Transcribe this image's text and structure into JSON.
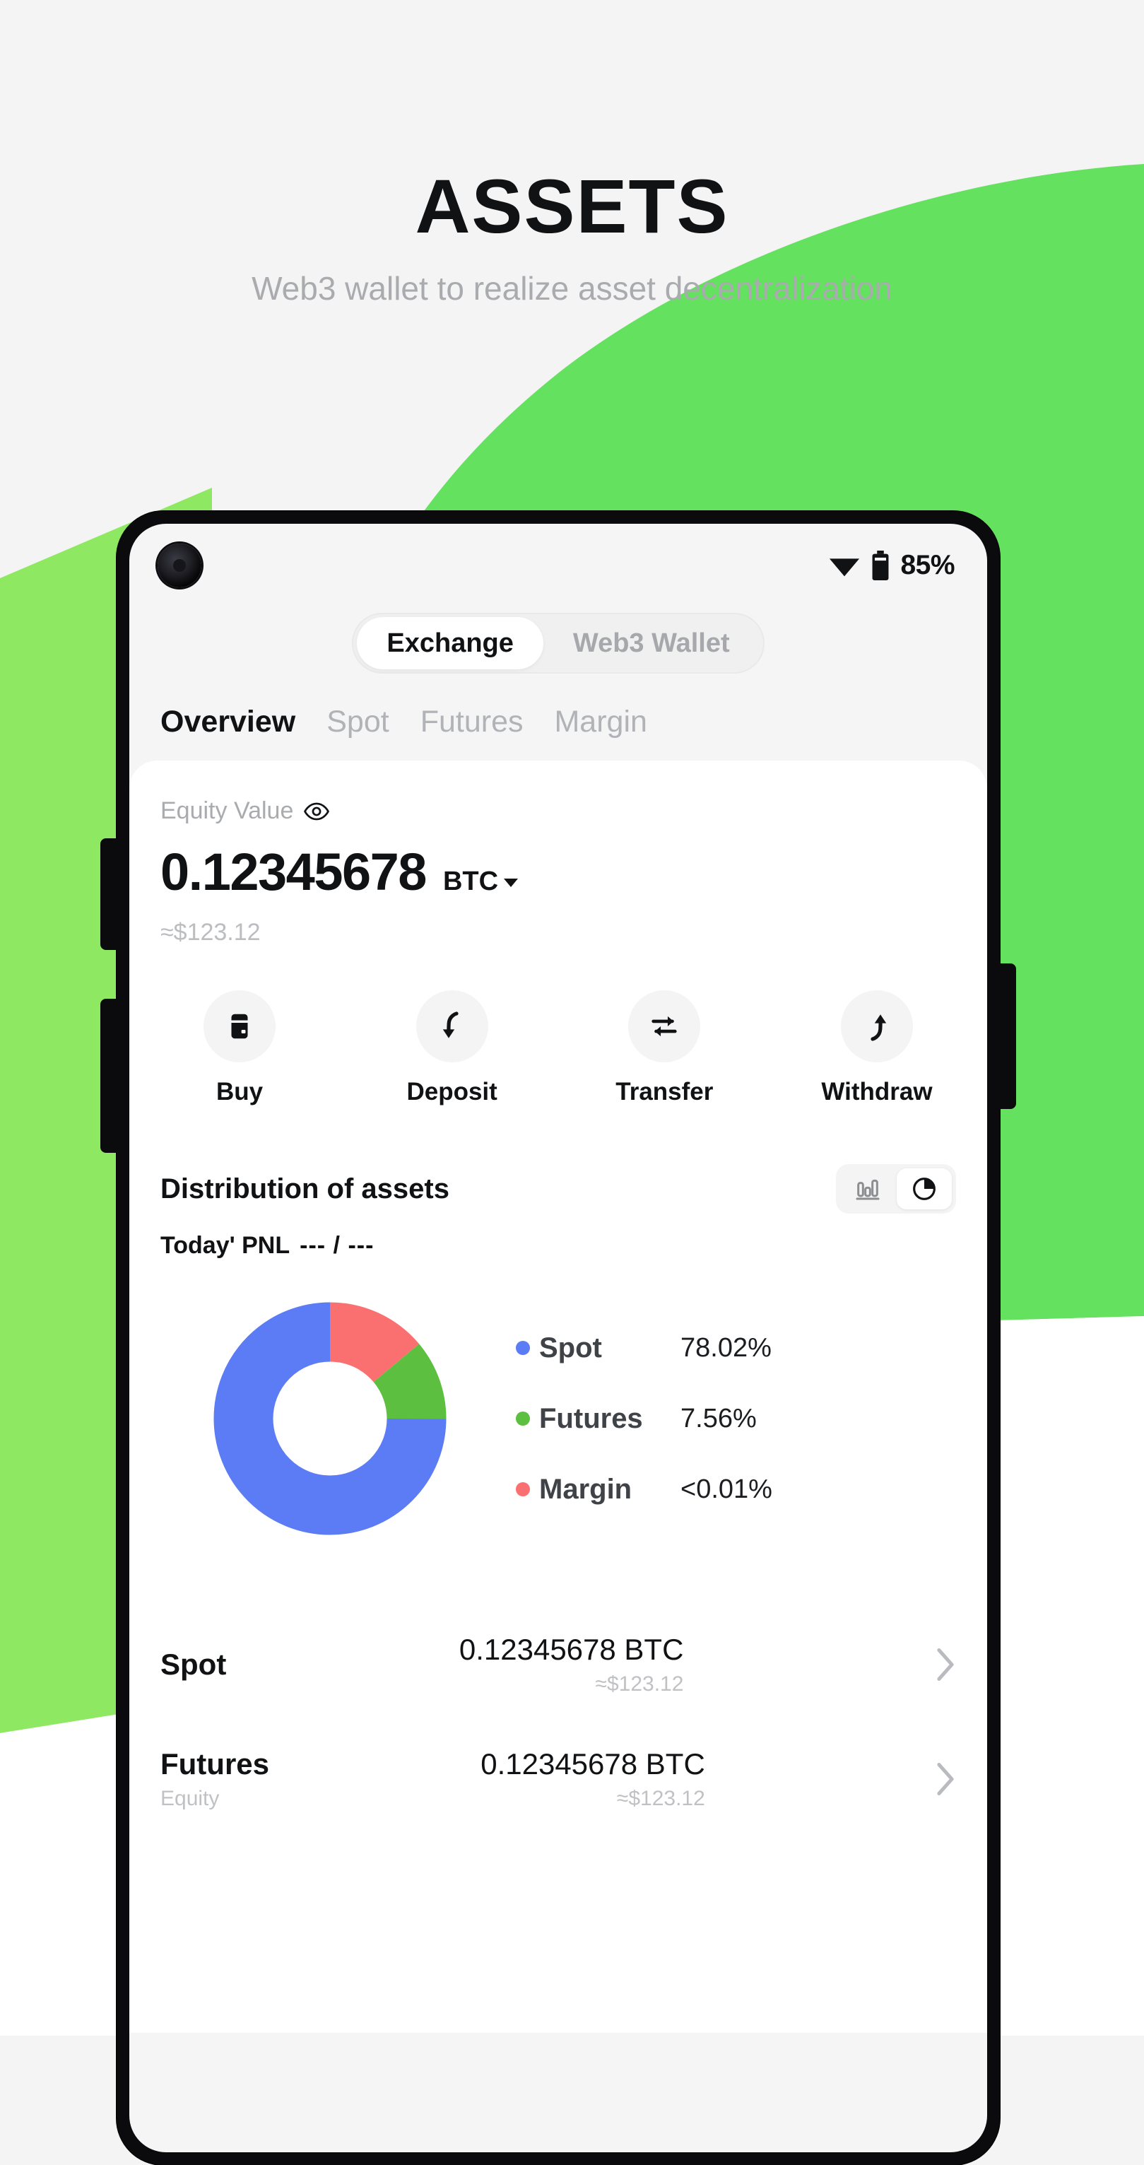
{
  "hero": {
    "title": "ASSETS",
    "subtitle": "Web3  wallet  to realize asset decentralization"
  },
  "colors": {
    "background": "#f4f4f4",
    "accent_green": "#64e15f",
    "accent_green_light": "#8ee861",
    "spot_blue": "#5b7cf5",
    "futures_green": "#5dbf3f",
    "margin_red": "#fa7070",
    "text_primary": "#111214",
    "text_muted": "#a9abae"
  },
  "status_bar": {
    "battery_percent": "85%",
    "wifi_icon": "wifi-icon",
    "battery_icon": "battery-icon",
    "camera_icon": "front-camera"
  },
  "top_switch": {
    "items": [
      {
        "label": "Exchange",
        "active": true
      },
      {
        "label": "Web3 Wallet",
        "active": false
      }
    ]
  },
  "sub_tabs": [
    {
      "label": "Overview",
      "active": true
    },
    {
      "label": "Spot",
      "active": false
    },
    {
      "label": "Futures",
      "active": false
    },
    {
      "label": "Margin",
      "active": false
    }
  ],
  "equity": {
    "label": "Equity Value",
    "eye_icon": "eye-icon",
    "amount": "0.12345678",
    "unit": "BTC",
    "usd": "≈$123.12"
  },
  "actions": [
    {
      "label": "Buy",
      "icon": "card-icon"
    },
    {
      "label": "Deposit",
      "icon": "arrow-down-curved-icon"
    },
    {
      "label": "Transfer",
      "icon": "transfer-arrows-icon"
    },
    {
      "label": "Withdraw",
      "icon": "arrow-up-curved-icon"
    }
  ],
  "distribution": {
    "title": "Distribution of assets",
    "pnl_label": "Today' PNL",
    "pnl_value": "--- / ---",
    "toggle": [
      {
        "icon": "bar-chart-icon",
        "active": false
      },
      {
        "icon": "pie-chart-icon",
        "active": true
      }
    ]
  },
  "chart_data": {
    "type": "pie",
    "title": "Distribution of assets",
    "subtype": "donut",
    "categories": [
      "Spot",
      "Futures",
      "Margin"
    ],
    "values": [
      78.02,
      7.56,
      0.01
    ],
    "value_labels": [
      "78.02%",
      "7.56%",
      "<0.01%"
    ],
    "colors": [
      "#5b7cf5",
      "#5dbf3f",
      "#fa7070"
    ],
    "legend_position": "right",
    "start_angle_deg": 0,
    "direction": "clockwise",
    "slice_order_from_top_clockwise": [
      "Margin",
      "Futures",
      "Spot"
    ],
    "rendered_sweeps_deg": [
      50,
      40,
      270
    ],
    "inner_radius_ratio": 0.6
  },
  "asset_rows": [
    {
      "name": "Spot",
      "sub": "",
      "amount": "0.12345678 BTC",
      "usd": "≈$123.12",
      "chevron": "chevron-right-icon"
    },
    {
      "name": "Futures",
      "sub": "Equity",
      "amount": "0.12345678 BTC",
      "usd": "≈$123.12",
      "chevron": "chevron-right-icon"
    }
  ]
}
